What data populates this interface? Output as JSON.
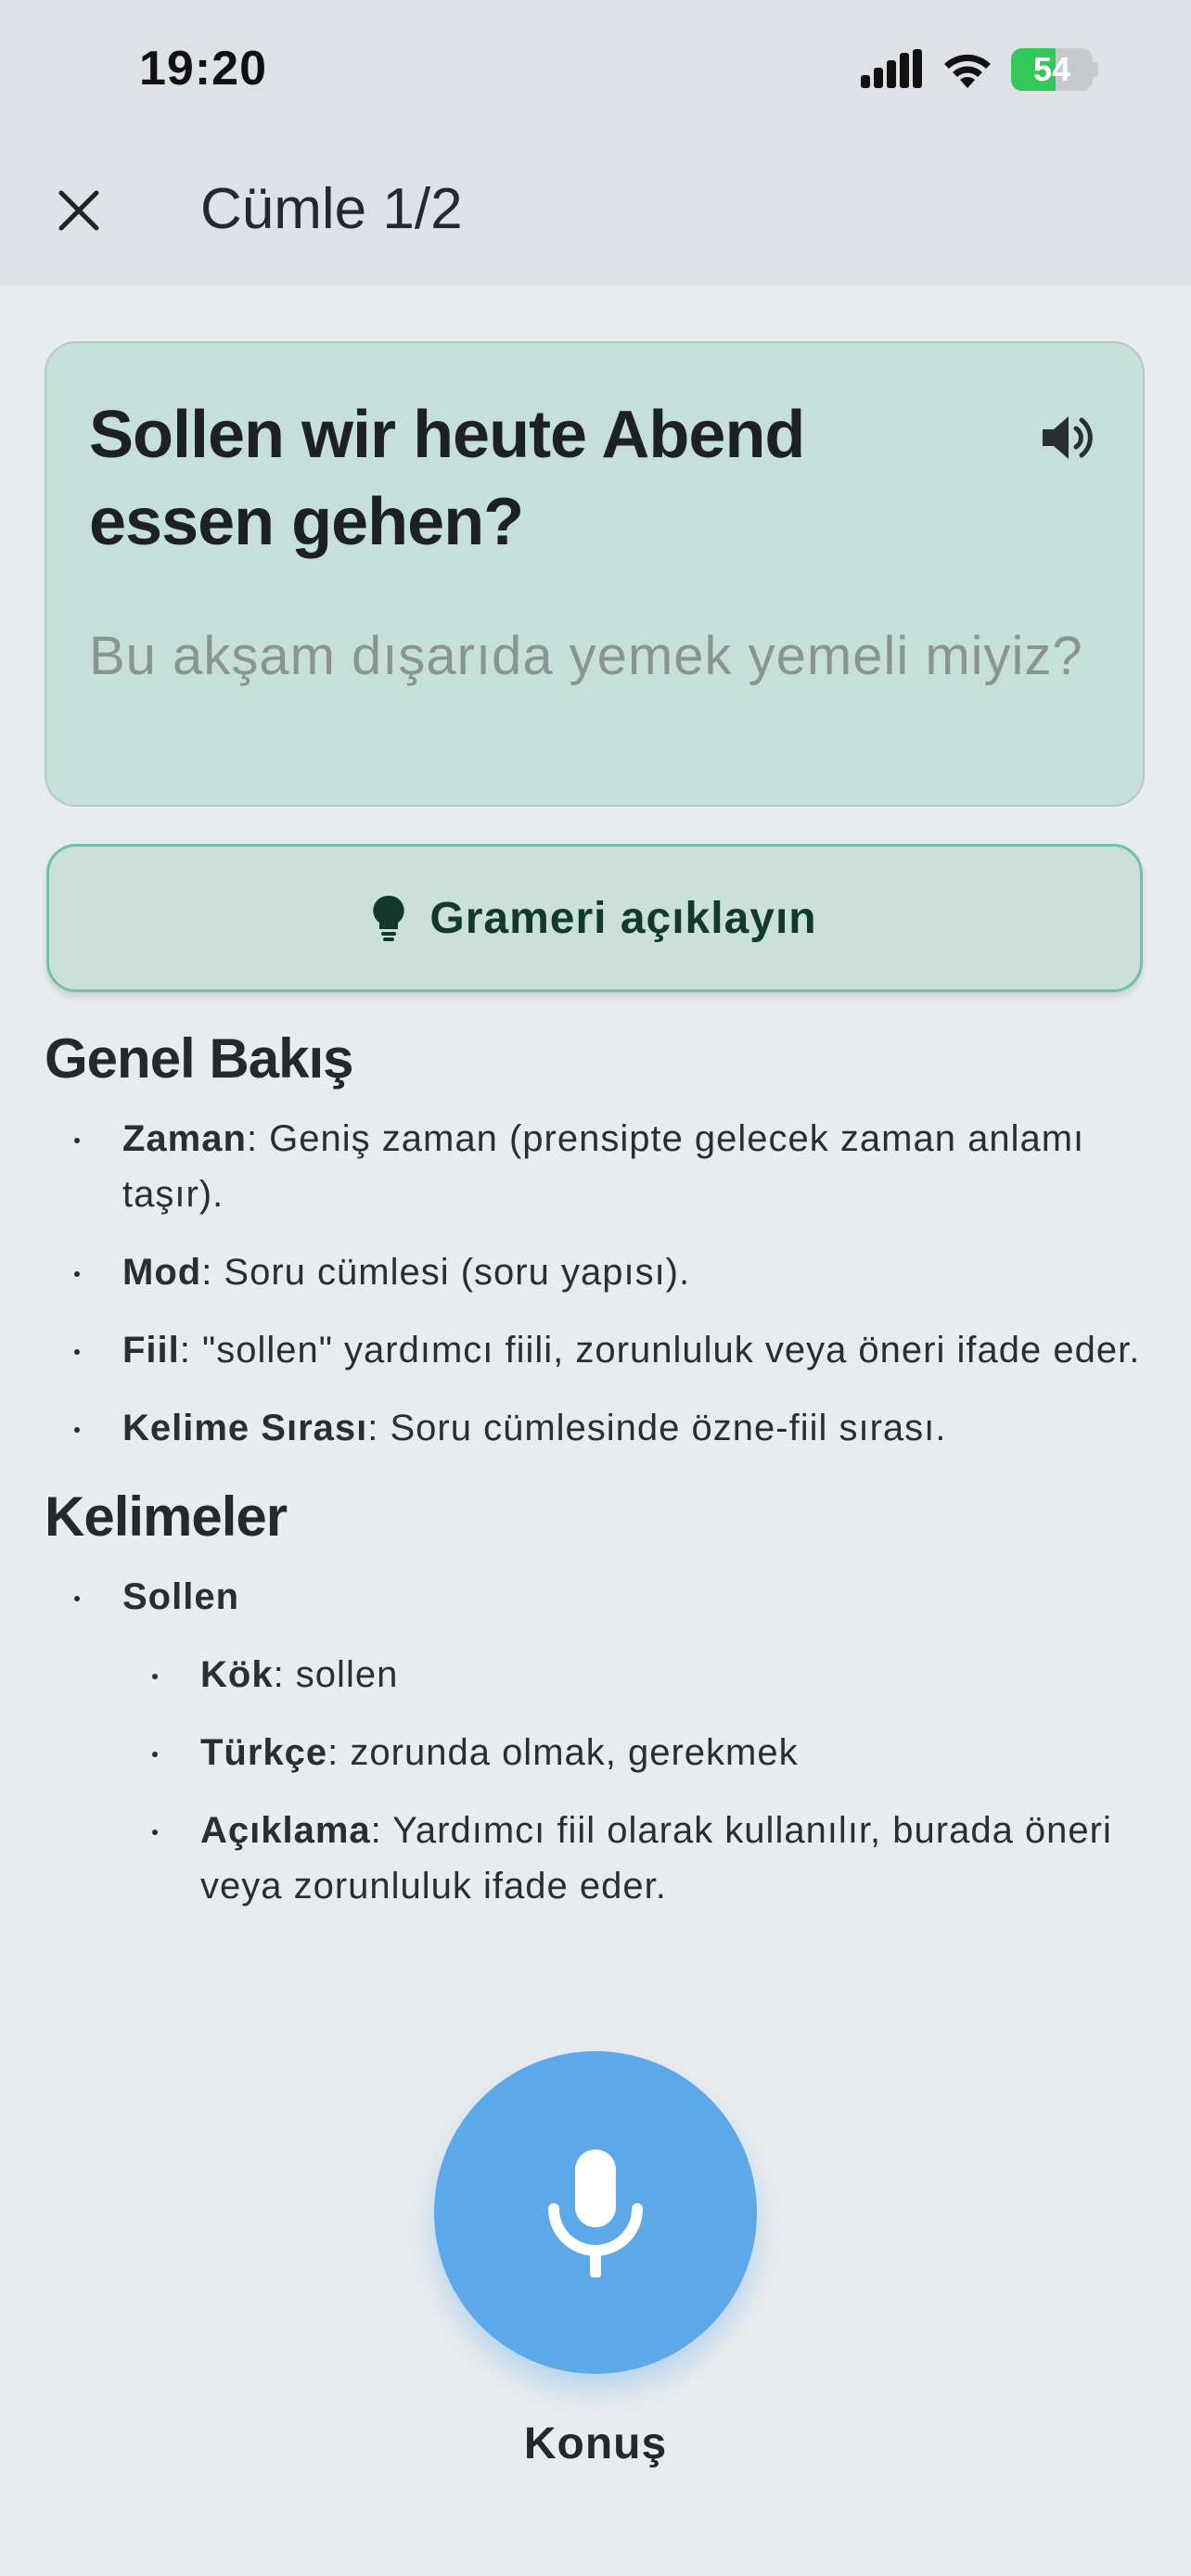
{
  "status_bar": {
    "time": "19:20",
    "battery": "54"
  },
  "header": {
    "title": "Cümle 1/2"
  },
  "sentence": {
    "text": "Sollen wir heute Abend essen gehen?",
    "translation": "Bu akşam dışarıda yemek yemeli miyiz?"
  },
  "grammar_button": {
    "label": "Grameri açıklayın"
  },
  "overview": {
    "title": "Genel Bakış",
    "items": [
      {
        "term": "Zaman",
        "desc": ": Geniş zaman (prensipte gelecek zaman anlamı taşır)."
      },
      {
        "term": "Mod",
        "desc": ": Soru cümlesi (soru yapısı)."
      },
      {
        "term": "Fiil",
        "desc": ": \"sollen\" yardımcı fiili, zorunluluk veya öneri ifade eder."
      },
      {
        "term": "Kelime Sırası",
        "desc": ": Soru cümlesinde özne-fiil sırası."
      }
    ]
  },
  "words": {
    "title": "Kelimeler",
    "items": [
      {
        "word": "Sollen",
        "details": [
          {
            "term": "Kök",
            "desc": ": sollen"
          },
          {
            "term": "Türkçe",
            "desc": ": zorunda olmak, gerekmek"
          },
          {
            "term": "Açıklama",
            "desc": ": Yardımcı fiil olarak kullanılır, burada öneri veya zorunluluk ifade eder."
          }
        ]
      }
    ]
  },
  "speak": {
    "label": "Konuş"
  },
  "colors": {
    "card_bg": "#c5e0d8",
    "button_border": "#6cc4a5",
    "mic": "#5da8e9",
    "battery": "#34c759"
  }
}
